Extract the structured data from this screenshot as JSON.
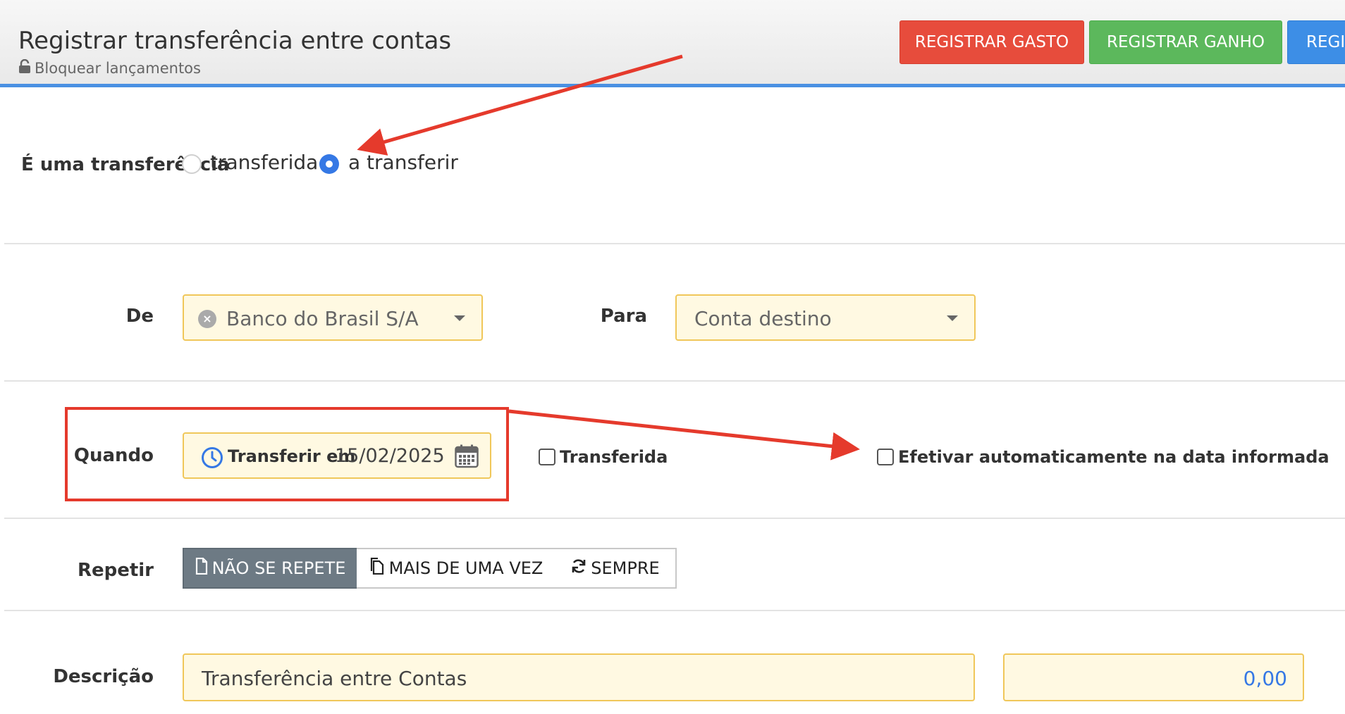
{
  "header": {
    "title": "Registrar transferência entre contas",
    "lock_label": "Bloquear lançamentos",
    "buttons": {
      "gasto": "REGISTRAR GASTO",
      "ganho": "REGISTRAR GANHO",
      "third": "REGIS"
    }
  },
  "form": {
    "tipo": {
      "label": "É uma transferência",
      "options": [
        "transferida",
        "a transferir"
      ],
      "selected": "a transferir"
    },
    "de": {
      "label": "De",
      "value": "Banco do Brasil S/A"
    },
    "para": {
      "label": "Para",
      "placeholder": "Conta destino"
    },
    "quando": {
      "label": "Quando",
      "prefix": "Transferir em",
      "date": "15/02/2025",
      "transferida_label": "Transferida",
      "efetivar_label": "Efetivar automaticamente na data informada"
    },
    "repetir": {
      "label": "Repetir",
      "options": [
        "NÃO SE REPETE",
        "MAIS DE UMA VEZ",
        "SEMPRE"
      ],
      "selected": "NÃO SE REPETE"
    },
    "descricao": {
      "label": "Descrição",
      "value": "Transferência entre Contas",
      "amount": "0,00"
    }
  },
  "colors": {
    "accent_blue": "#4a90e2",
    "btn_gasto": "#e74c3c",
    "btn_ganho": "#5cb85c",
    "btn_third": "#3d8ee6",
    "field_bg": "#fff9e2",
    "field_border": "#f0c75a",
    "annotation_red": "#e53a2c"
  }
}
